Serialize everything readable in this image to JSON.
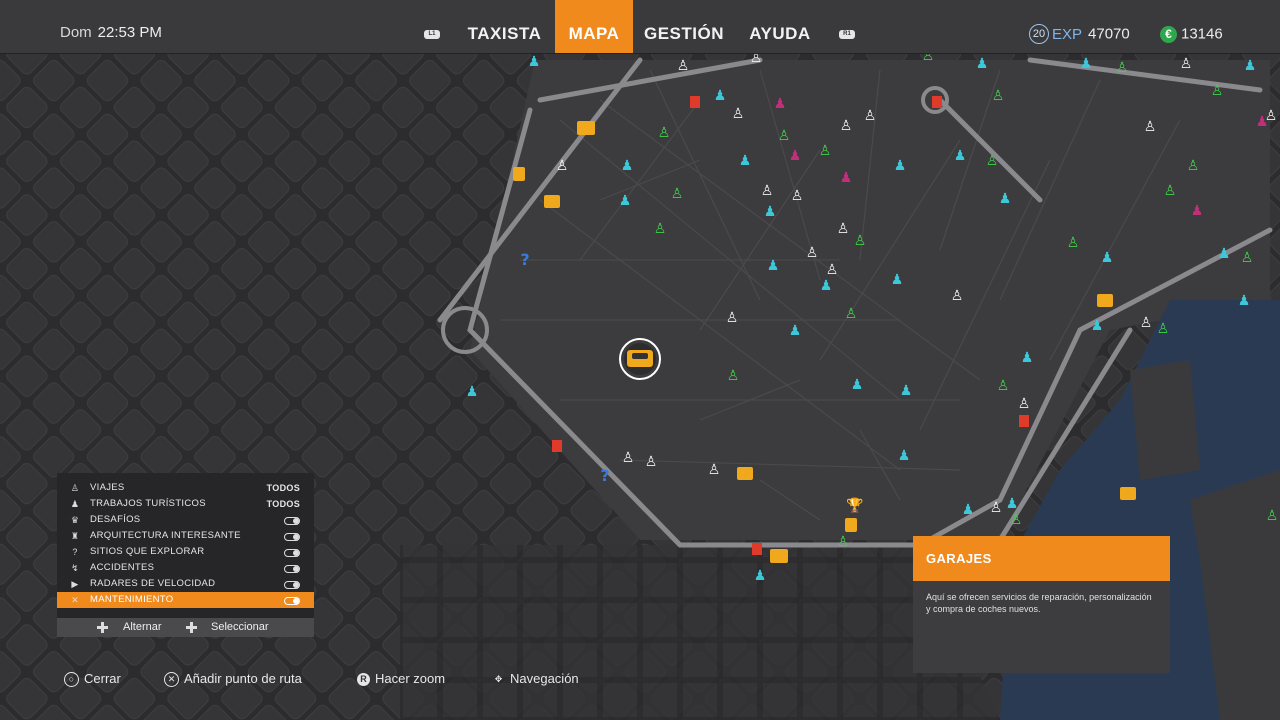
{
  "header": {
    "day": "Dom",
    "time": "22:53 PM",
    "left_bumper": "L1",
    "right_bumper": "R1",
    "tabs": [
      {
        "label": "TAXISTA",
        "active": false
      },
      {
        "label": "MAPA",
        "active": true
      },
      {
        "label": "GESTIÓN",
        "active": false
      },
      {
        "label": "AYUDA",
        "active": false
      }
    ],
    "level": "20",
    "exp_label": "EXP",
    "exp_value": "47070",
    "money_value": "13146",
    "money_icon": "euro-coin-icon"
  },
  "legend": {
    "items": [
      {
        "icon": "passenger-icon",
        "label": "VIAJES",
        "value": "TODOS",
        "toggle": false,
        "selected": false
      },
      {
        "icon": "tourist-icon",
        "label": "TRABAJOS TURÍSTICOS",
        "value": "TODOS",
        "toggle": false,
        "selected": false
      },
      {
        "icon": "trophy-icon",
        "label": "DESAFÍOS",
        "value": "",
        "toggle": true,
        "selected": false
      },
      {
        "icon": "monument-icon",
        "label": "ARQUITECTURA INTERESANTE",
        "value": "",
        "toggle": true,
        "selected": false
      },
      {
        "icon": "question-icon",
        "label": "SITIOS QUE EXPLORAR",
        "value": "",
        "toggle": true,
        "selected": false
      },
      {
        "icon": "accident-icon",
        "label": "ACCIDENTES",
        "value": "",
        "toggle": true,
        "selected": false
      },
      {
        "icon": "speed-camera-icon",
        "label": "RADARES DE VELOCIDAD",
        "value": "",
        "toggle": true,
        "selected": false
      },
      {
        "icon": "wrench-icon",
        "label": "MANTENIMIENTO",
        "value": "",
        "toggle": true,
        "selected": true
      }
    ],
    "hint_toggle": "Alternar",
    "hint_select": "Seleccionar"
  },
  "info_panel": {
    "title": "GARAJES",
    "description": "Aquí se ofrecen servicios de reparación, personalización y compra de coches nuevos."
  },
  "controls": [
    {
      "icon": "circle-button-icon",
      "glyph": "○",
      "label": "Cerrar"
    },
    {
      "icon": "cross-button-icon",
      "glyph": "✕",
      "label": "Añadir punto de ruta"
    },
    {
      "icon": "right-stick-icon",
      "glyph": "R",
      "label": "Hacer zoom"
    },
    {
      "icon": "left-stick-icon",
      "glyph": "✥",
      "label": "Navegación"
    }
  ],
  "colors": {
    "accent": "#f08a1c",
    "tourist": "#3cc8d8",
    "passenger_green": "#3fd14a",
    "passenger_white": "#f0f0f0",
    "challenge_pink": "#c0307a",
    "garage": "#f0a81c",
    "water": "#2a3a52"
  }
}
